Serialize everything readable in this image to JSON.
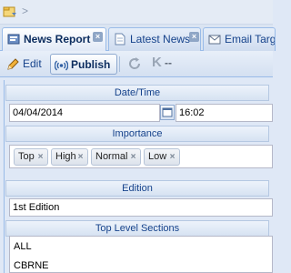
{
  "breadcrumb": {
    "separator": ">"
  },
  "tabs": [
    {
      "label": "News Report",
      "active": true,
      "icon": "report-icon"
    },
    {
      "label": "Latest News",
      "active": false,
      "icon": "page-icon"
    },
    {
      "label": "Email Targe",
      "active": false,
      "icon": "email-icon"
    }
  ],
  "toolbar": {
    "edit_label": "Edit",
    "publish_label": "Publish",
    "k_glyph": "K",
    "dash_glyph": "--"
  },
  "form": {
    "datetime": {
      "header": "Date/Time",
      "date_value": "04/04/2014",
      "time_value": "16:02"
    },
    "importance": {
      "header": "Importance",
      "tags": [
        "Top",
        "High",
        "Normal",
        "Low"
      ]
    },
    "edition": {
      "header": "Edition",
      "value": "1st Edition"
    },
    "sections": {
      "header": "Top Level Sections",
      "items": [
        "ALL",
        "CBRNE"
      ]
    }
  },
  "colors": {
    "accent": "#15428b",
    "border": "#99bbe8",
    "background": "#dfe8f6"
  }
}
